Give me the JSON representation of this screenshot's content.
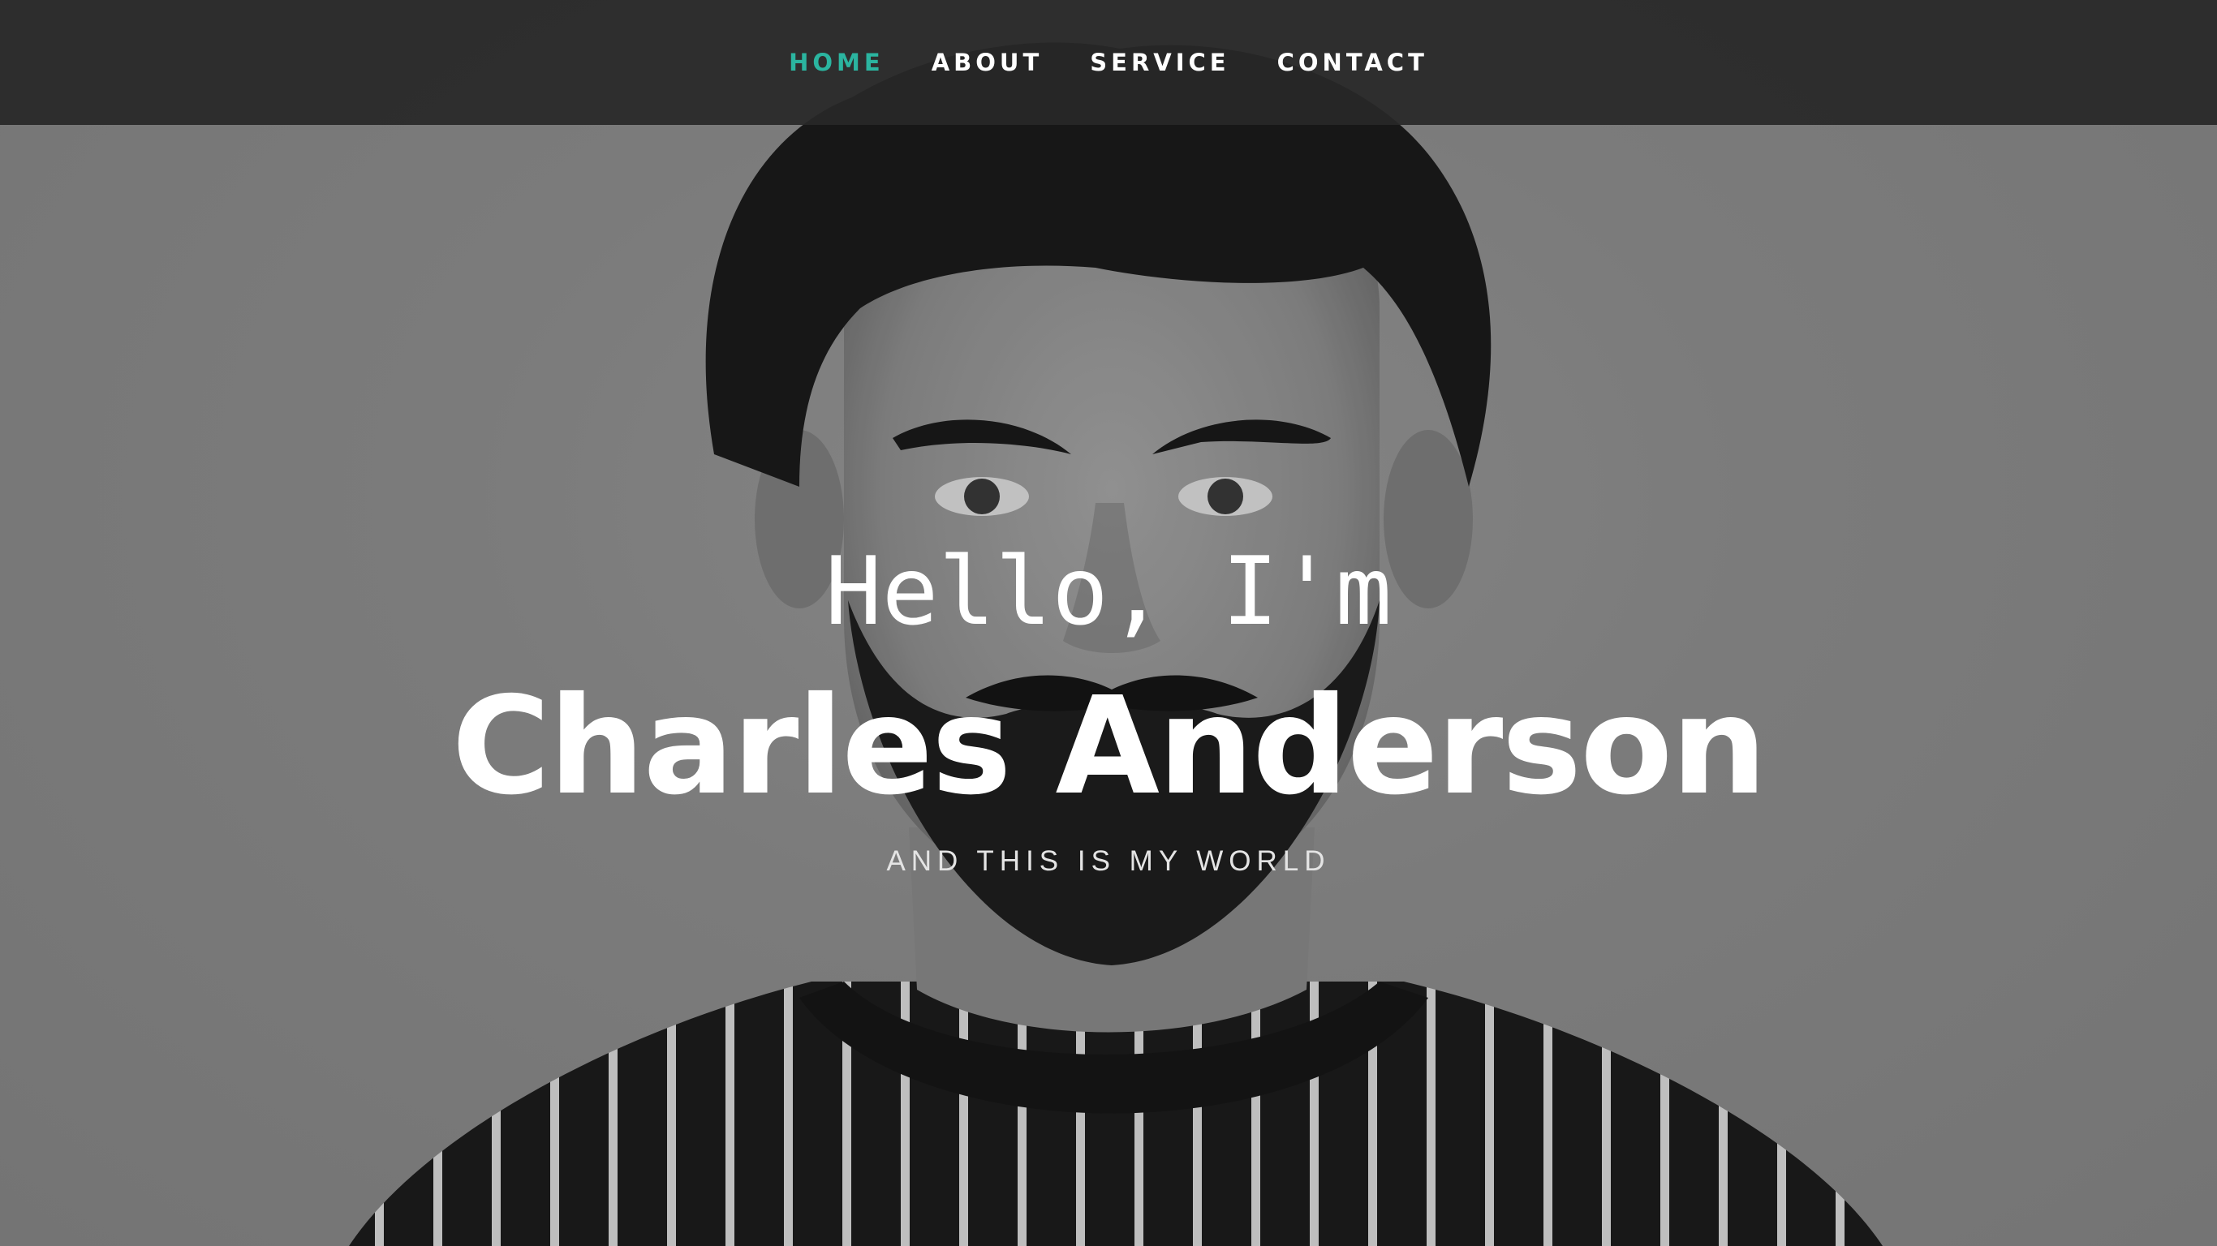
{
  "nav": {
    "items": [
      {
        "label": "HOME",
        "active": true
      },
      {
        "label": "ABOUT",
        "active": false
      },
      {
        "label": "SERVICE",
        "active": false
      },
      {
        "label": "CONTACT",
        "active": false
      }
    ],
    "active_color": "#2bb5a0",
    "background_color": "#2a2a2a"
  },
  "hero": {
    "greeting": "Hello, I'm",
    "name": "Charles Anderson",
    "tagline": "AND THIS IS MY WORLD",
    "background_image": "grayscale portrait photo"
  }
}
